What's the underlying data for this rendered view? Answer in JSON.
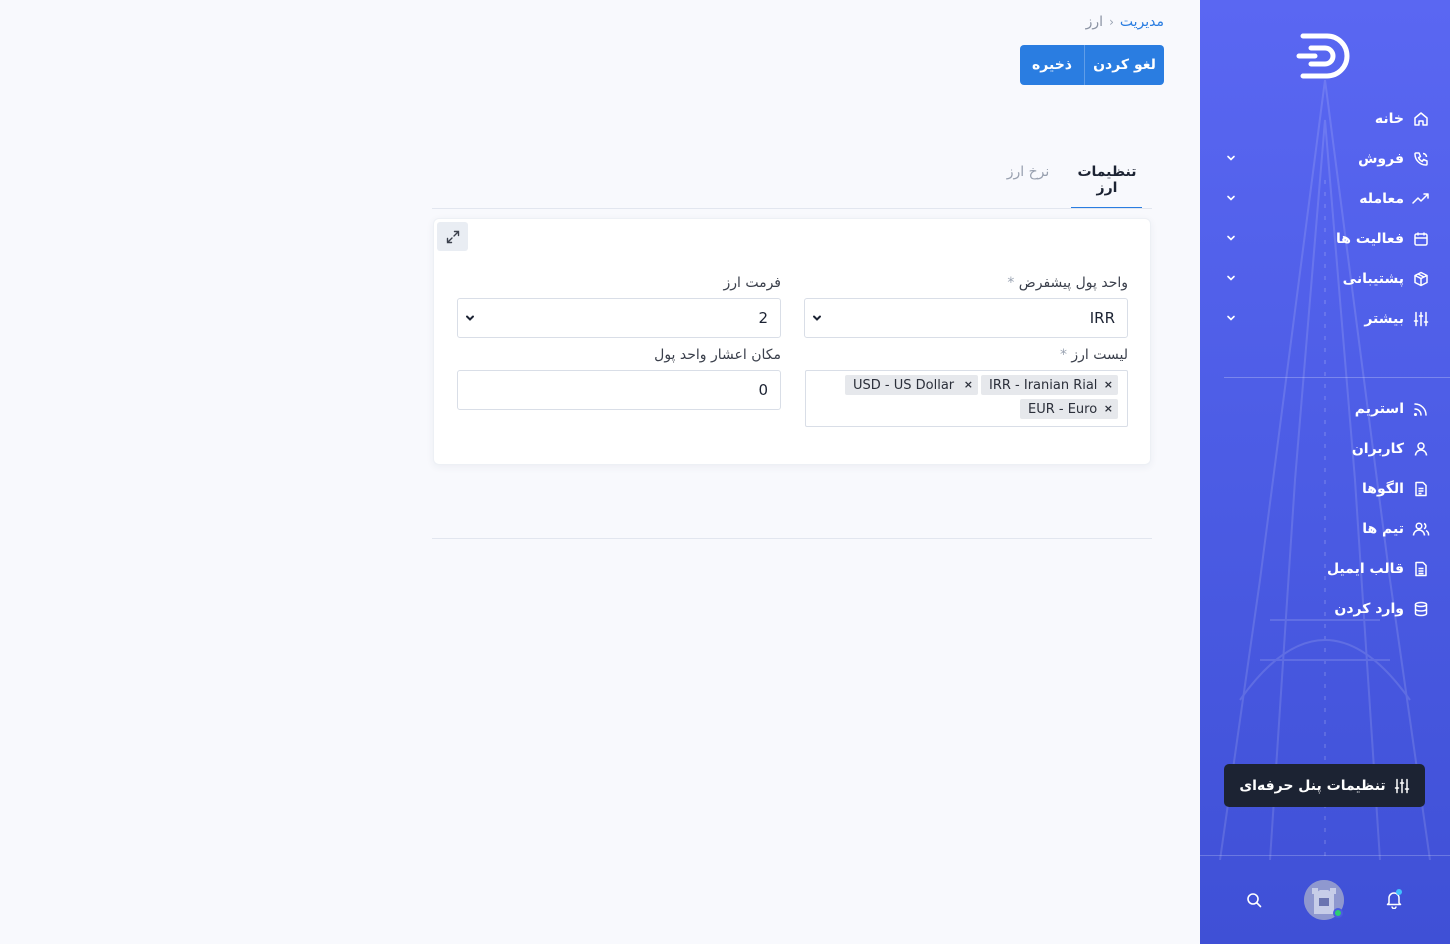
{
  "breadcrumb": {
    "parent": "مدیریت",
    "separator": "›",
    "current": "ارز"
  },
  "actions": {
    "save": "ذخیره",
    "cancel": "لغو کردن"
  },
  "tabs": [
    {
      "label": "تنظیمات ارز",
      "active": true
    },
    {
      "label": "نرخ ارز",
      "active": false
    }
  ],
  "form": {
    "default_currency": {
      "label": "واحد پول پیشفرض",
      "required_mark": "*",
      "value": "IRR"
    },
    "currency_format": {
      "label": "فرمت ارز",
      "value": "2"
    },
    "currency_list": {
      "label": "لیست ارز",
      "required_mark": "*",
      "tags": [
        "IRR - Iranian Rial",
        "USD - US Dollar",
        "EUR - Euro"
      ],
      "remove_glyph": "×"
    },
    "decimal_places": {
      "label": "مکان اعشار واحد پول",
      "value": "0"
    }
  },
  "sidebar": {
    "items": [
      {
        "label": "خانه",
        "icon": "home-icon",
        "has_submenu": false
      },
      {
        "label": "فروش",
        "icon": "phone-icon",
        "has_submenu": true
      },
      {
        "label": "معامله",
        "icon": "trending-icon",
        "has_submenu": true
      },
      {
        "label": "فعالیت ها",
        "icon": "calendar-icon",
        "has_submenu": true
      },
      {
        "label": "پشتیبانی",
        "icon": "box-icon",
        "has_submenu": true
      },
      {
        "label": "بیشتر",
        "icon": "sliders-icon",
        "has_submenu": true
      }
    ],
    "secondary_items": [
      {
        "label": "استریم",
        "icon": "rss-icon"
      },
      {
        "label": "کاربران",
        "icon": "user-icon"
      },
      {
        "label": "الگوها",
        "icon": "file-icon"
      },
      {
        "label": "تیم ها",
        "icon": "users-icon"
      },
      {
        "label": "قالب ایمیل",
        "icon": "file-text-icon"
      },
      {
        "label": "وارد کردن",
        "icon": "database-icon"
      }
    ],
    "pro_settings": "تنظیمات پنل حرفه‌ای"
  },
  "colors": {
    "accent": "#2a7de1",
    "sidebar_top": "#5a67f2",
    "sidebar_bottom": "#3f50d6",
    "dark_button": "#1c2333",
    "online": "#2ecc71"
  }
}
